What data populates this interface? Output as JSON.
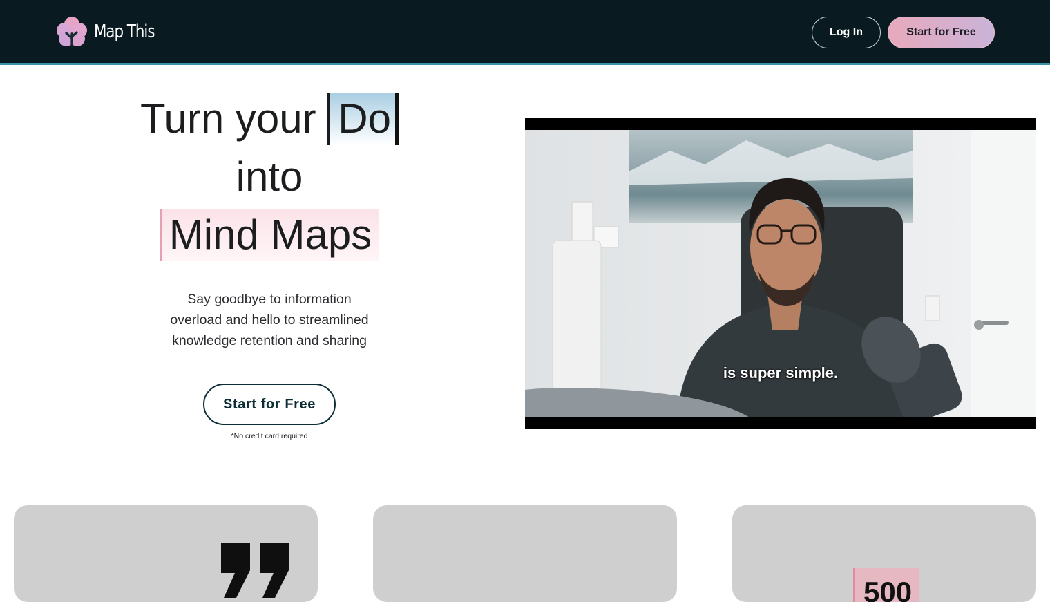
{
  "nav": {
    "brand": "Map This",
    "login_label": "Log In",
    "start_label": "Start for Free"
  },
  "hero": {
    "line1_prefix": "Turn your",
    "typed_word": "Do",
    "line2": "into",
    "line3": "Mind Maps",
    "subtitle": "Say goodbye to information overload and hello to streamlined knowledge retention and sharing",
    "cta_label": "Start for Free",
    "note": "*No credit card required"
  },
  "video": {
    "caption": "is super simple."
  },
  "cards": {
    "stat_value": "500"
  },
  "colors": {
    "nav_bg": "#091b21",
    "nav_border": "#3a93a8",
    "accent_pink": "#e8a9bc",
    "accent_purple": "#c9b3d8",
    "cta_border": "#0d2e36",
    "card_bg": "#cfcfcf"
  }
}
